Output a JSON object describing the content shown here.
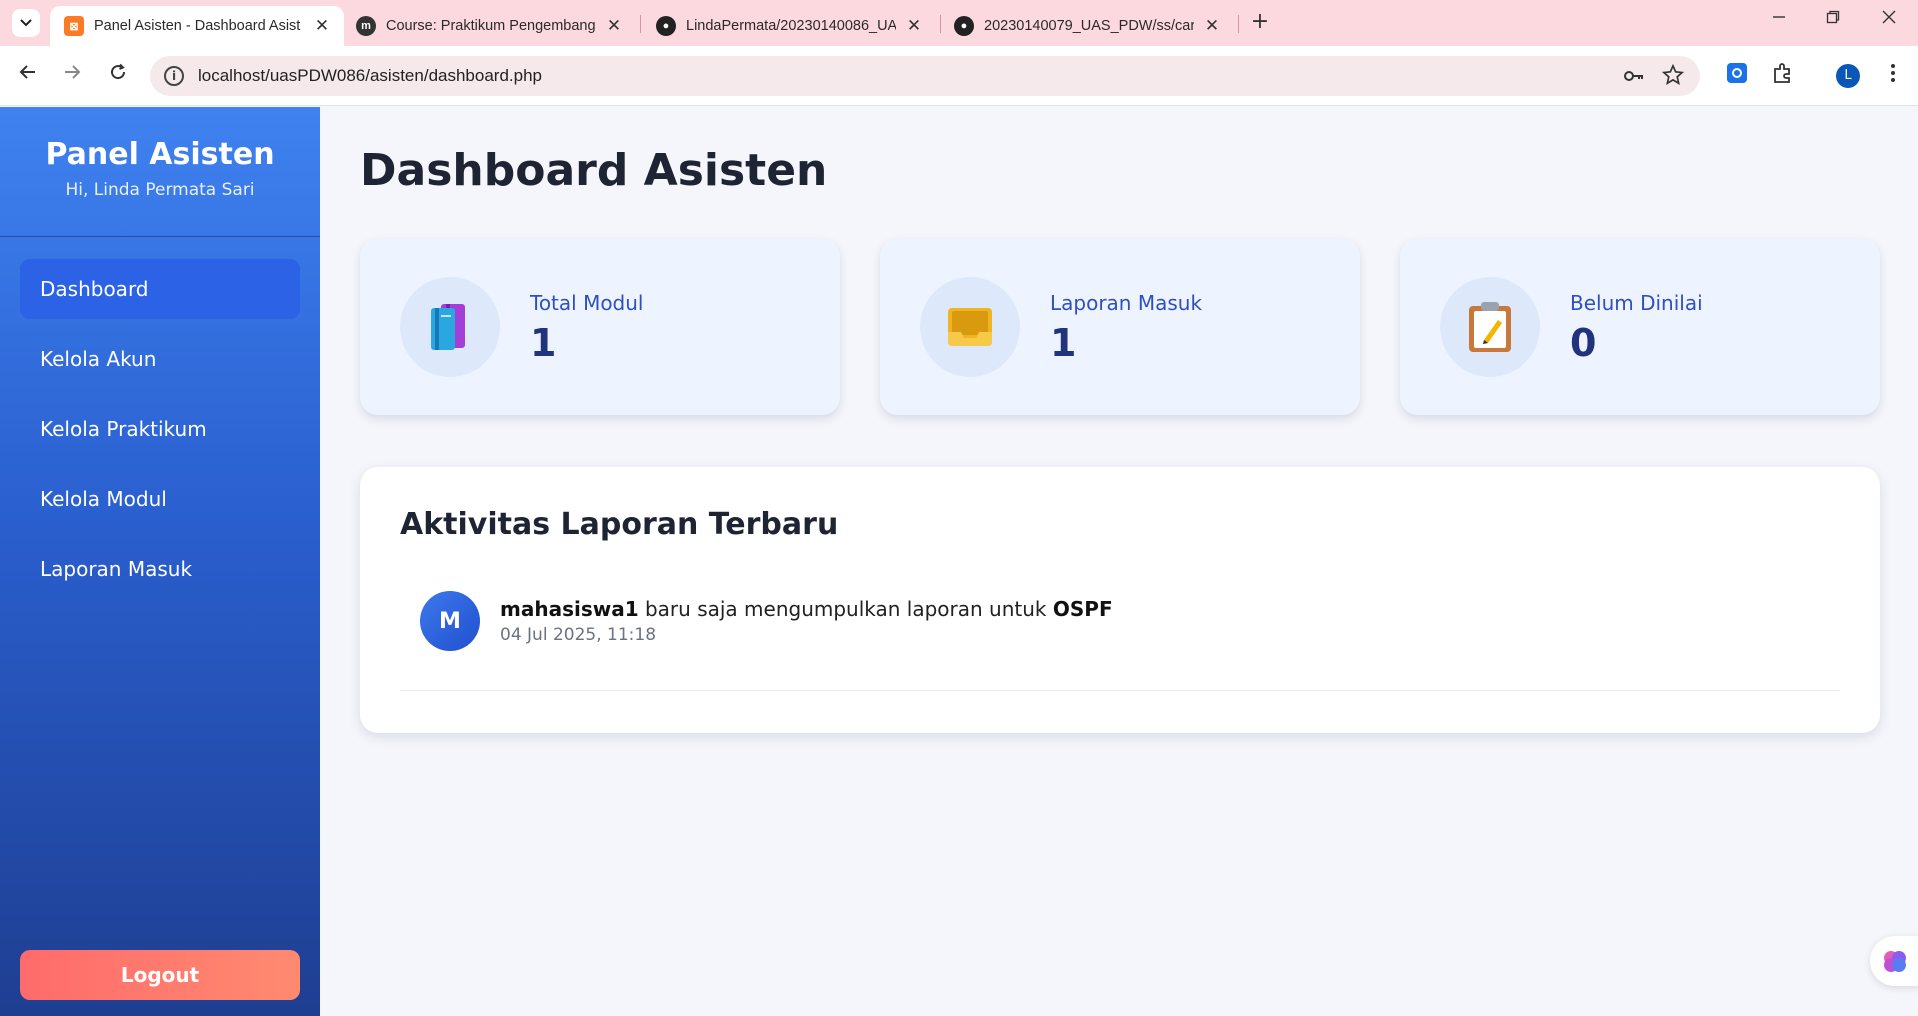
{
  "browser": {
    "tabs": [
      {
        "title": "Panel Asisten - Dashboard Asist",
        "active": true,
        "icon": "xampp-icon"
      },
      {
        "title": "Course: Praktikum Pengembang",
        "active": false,
        "icon": "moodle-icon"
      },
      {
        "title": "LindaPermata/20230140086_UA",
        "active": false,
        "icon": "github-icon"
      },
      {
        "title": "20230140079_UAS_PDW/ss/car",
        "active": false,
        "icon": "github-icon"
      }
    ],
    "close_glyph": "✕",
    "new_tab_glyph": "+",
    "url": "localhost/uasPDW086/asisten/dashboard.php",
    "profile_initial": "L"
  },
  "sidebar": {
    "title": "Panel Asisten",
    "subtitle": "Hi, Linda Permata Sari",
    "items": [
      {
        "label": "Dashboard",
        "active": true
      },
      {
        "label": "Kelola Akun"
      },
      {
        "label": "Kelola Praktikum"
      },
      {
        "label": "Kelola Modul"
      },
      {
        "label": "Laporan Masuk"
      }
    ],
    "logout": "Logout"
  },
  "main": {
    "title": "Dashboard Asisten",
    "stats": [
      {
        "label": "Total Modul",
        "value": "1",
        "icon": "books-icon"
      },
      {
        "label": "Laporan Masuk",
        "value": "1",
        "icon": "inbox-tray-icon"
      },
      {
        "label": "Belum Dinilai",
        "value": "0",
        "icon": "clipboard-icon"
      }
    ],
    "activity": {
      "title": "Aktivitas Laporan Terbaru",
      "items": [
        {
          "initial": "M",
          "user": "mahasiswa1",
          "middle": " baru saja mengumpulkan laporan untuk ",
          "module": "OSPF",
          "time": "04 Jul 2025, 11:18"
        }
      ]
    }
  },
  "colors": {
    "sidebar_top": "#3f82f0",
    "sidebar_bottom": "#1e3e91",
    "active_item": "#2b62e6",
    "logout_start": "#ff6b6b",
    "logout_end": "#ff8a70",
    "stat_value": "#22337d",
    "stat_label": "#2f4fc0"
  }
}
